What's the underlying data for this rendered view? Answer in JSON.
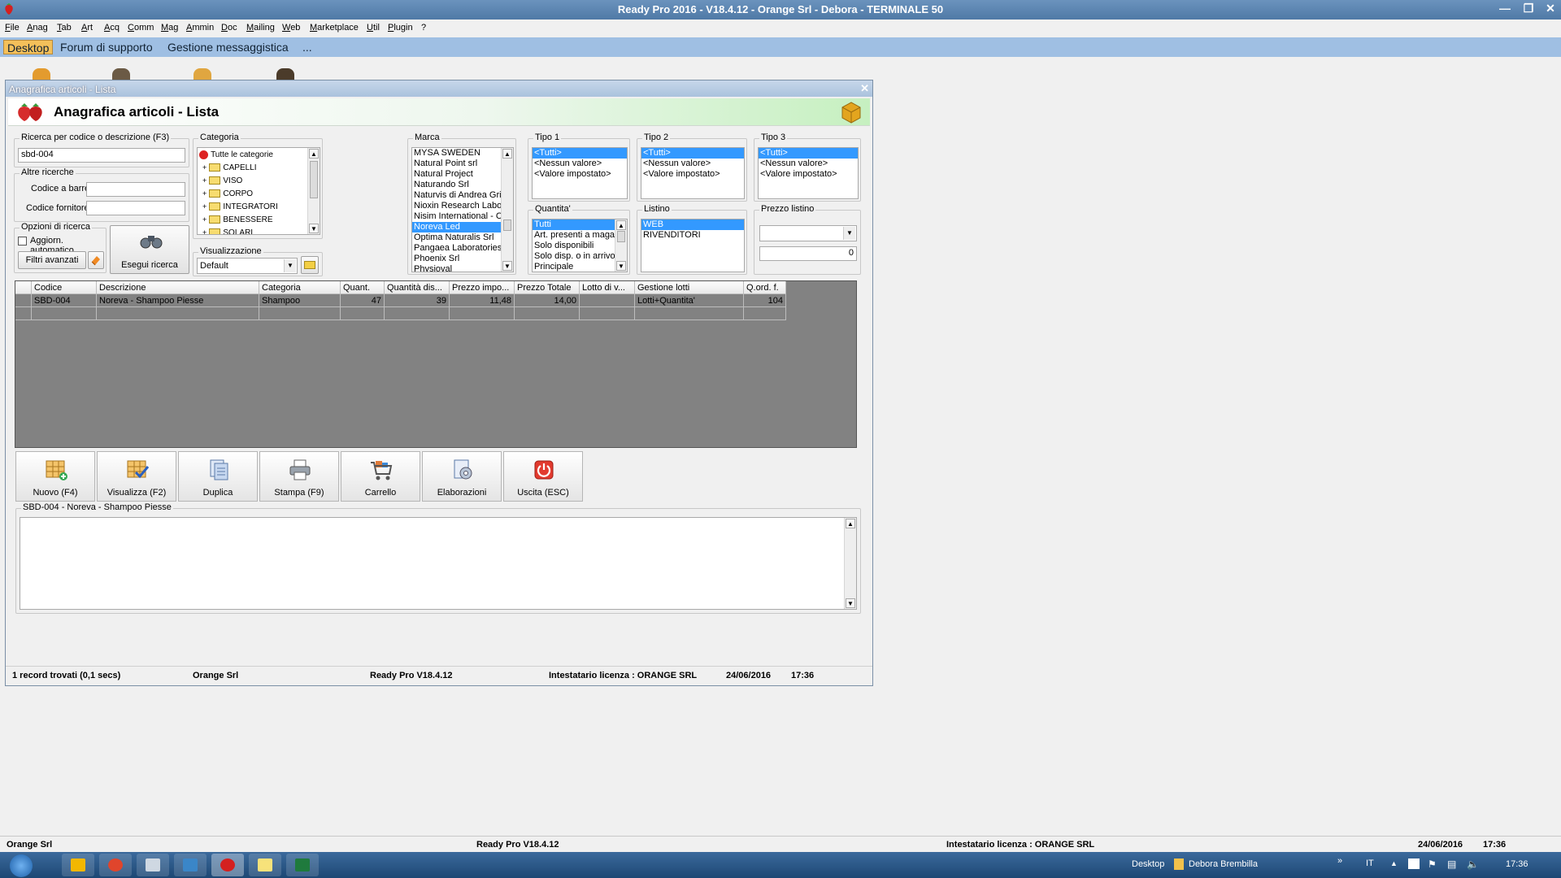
{
  "titlebar": {
    "title": "Ready Pro 2016 - V18.4.12 - Orange Srl - Debora - TERMINALE 50"
  },
  "menu": [
    "File",
    "Anag",
    "Tab",
    "Art",
    "Acq",
    "Comm",
    "Mag",
    "Ammin",
    "Doc",
    "Mailing",
    "Web",
    "Marketplace",
    "Util",
    "Plugin",
    "?"
  ],
  "tabs": [
    "Desktop",
    "Forum di supporto",
    "Gestione messaggistica",
    "..."
  ],
  "window": {
    "title": "Anagrafica articoli  - Lista",
    "header": "Anagrafica articoli  - Lista"
  },
  "search": {
    "caption": "Ricerca per codice o descrizione (F3)",
    "value": "sbd-004",
    "other_caption": "Altre ricerche",
    "barcode_label": "Codice a barre :",
    "supplier_label": "Codice fornitore :",
    "options_caption": "Opzioni di ricerca",
    "auto_update_label": "Aggiorn. automatico",
    "advanced_filters": "Filtri avanzati",
    "run_search": "Esegui ricerca"
  },
  "categoria": {
    "caption": "Categoria",
    "root": "Tutte le categorie",
    "items": [
      "CAPELLI",
      "VISO",
      "CORPO",
      "INTEGRATORI",
      "BENESSERE",
      "SOLARI"
    ]
  },
  "visualizzazione": {
    "caption": "Visualizzazione",
    "value": "Default"
  },
  "marca": {
    "caption": "Marca",
    "items": [
      "MYSA SWEDEN",
      "Natural Point srl",
      "Natural Project",
      "Naturando Srl",
      "Naturvis di Andrea Grie",
      "Nioxin Research Labor",
      "Nisim International - C",
      "Noreva Led",
      "Optima Naturalis Srl",
      "Pangaea Laboratories",
      "Phoenix Srl",
      "Physioval"
    ],
    "selected": "Noreva Led"
  },
  "tipo1": {
    "caption": "Tipo 1",
    "items": [
      "<Tutti>",
      "<Nessun valore>",
      "<Valore impostato>"
    ]
  },
  "tipo2": {
    "caption": "Tipo 2",
    "items": [
      "<Tutti>",
      "<Nessun valore>",
      "<Valore impostato>"
    ]
  },
  "tipo3": {
    "caption": "Tipo 3",
    "items": [
      "<Tutti>",
      "<Nessun valore>",
      "<Valore impostato>"
    ]
  },
  "quantita": {
    "caption": "Quantita'",
    "items": [
      "Tutti",
      "Art. presenti a magaz",
      "Solo disponibili",
      "Solo disp. o in arrivo",
      "Principale"
    ]
  },
  "listino": {
    "caption": "Listino",
    "items": [
      "WEB",
      "RIVENDITORI"
    ]
  },
  "prezzo_listino": {
    "caption": "Prezzo listino",
    "value": "0"
  },
  "grid": {
    "columns": [
      "Codice",
      "Descrizione",
      "Categoria",
      "Quant.",
      "Quantità dis...",
      "Prezzo impo...",
      "Prezzo Totale",
      "Lotto di v...",
      "Gestione lotti",
      "Q.ord. f."
    ],
    "rows": [
      [
        "SBD-004",
        "Noreva - Shampoo Piesse",
        "Shampoo",
        "47",
        "39",
        "11,48",
        "14,00",
        "",
        "Lotti+Quantita'",
        "104"
      ]
    ]
  },
  "actions": [
    "Nuovo (F4)",
    "Visualizza (F2)",
    "Duplica",
    "Stampa (F9)",
    "Carrello",
    "Elaborazioni",
    "Uscita (ESC)"
  ],
  "notes": {
    "caption": "SBD-004 - Noreva - Shampoo Piesse"
  },
  "window_status": {
    "records": "1 record trovati (0,1 secs)",
    "company": "Orange Srl",
    "version": "Ready Pro V18.4.12",
    "license": "Intestatario licenza : ORANGE SRL",
    "date": "24/06/2016",
    "time": "17:36"
  },
  "app_status": {
    "company": "Orange Srl",
    "version": "Ready Pro V18.4.12",
    "license": "Intestatario licenza : ORANGE SRL",
    "date": "24/06/2016",
    "time": "17:36"
  },
  "taskbar": {
    "desktop": "Desktop",
    "user": "Debora Brembilla",
    "lang": "IT",
    "clock": "17:36"
  }
}
